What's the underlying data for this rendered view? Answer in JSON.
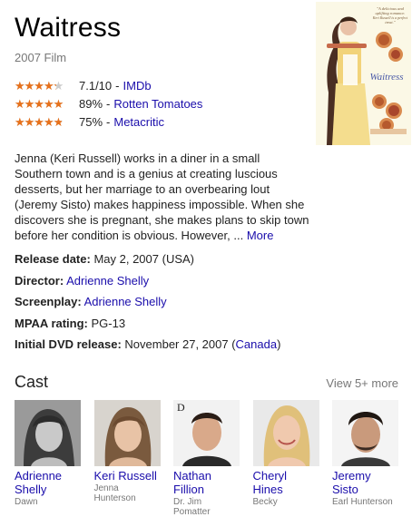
{
  "film": {
    "title": "Waitress",
    "subtitle": "2007 Film"
  },
  "poster": {
    "tagline_lines": [
      "\"A delicious and",
      "uplifting romance.",
      "Keri Russell is a perfect",
      "treat.\""
    ],
    "title": "Waitress"
  },
  "ratings": [
    {
      "stars": 3.5,
      "score": "7.1/10",
      "separator": "-",
      "source": "IMDb"
    },
    {
      "stars": 4.5,
      "score": "89%",
      "separator": "-",
      "source": "Rotten Tomatoes"
    },
    {
      "stars": 4.0,
      "score": "75%",
      "separator": "-",
      "source": "Metacritic"
    }
  ],
  "description": {
    "text": "Jenna (Keri Russell) works in a diner in a small Southern town and is a genius at creating luscious desserts, but her marriage to an overbearing lout (Jeremy Sisto) makes happiness impossible. When she discovers she is pregnant, she makes plans to skip town before her condition is obvious. However, ... ",
    "more": "More"
  },
  "facts": {
    "release": {
      "label": "Release date:",
      "value": "May 2, 2007 (USA)"
    },
    "director": {
      "label": "Director:",
      "link": "Adrienne Shelly"
    },
    "screenplay": {
      "label": "Screenplay:",
      "link": "Adrienne Shelly"
    },
    "mpaa": {
      "label": "MPAA rating:",
      "value": "PG-13"
    },
    "dvd": {
      "label": "Initial DVD release:",
      "value_before": "November 27, 2007 (",
      "link": "Canada",
      "value_after": ")"
    }
  },
  "cast": {
    "title": "Cast",
    "view_more": "View 5+ more",
    "members": [
      {
        "name_line1": "Adrienne",
        "name_line2": "Shelly",
        "role_line1": "Dawn",
        "role_line2": ""
      },
      {
        "name_line1": "Keri Russell",
        "name_line2": "",
        "role_line1": "Jenna",
        "role_line2": "Hunterson"
      },
      {
        "name_line1": "Nathan",
        "name_line2": "Fillion",
        "role_line1": "Dr. Jim",
        "role_line2": "Pomatter"
      },
      {
        "name_line1": "Cheryl",
        "name_line2": "Hines",
        "role_line1": "Becky",
        "role_line2": ""
      },
      {
        "name_line1": "Jeremy",
        "name_line2": "Sisto",
        "role_line1": "Earl Hunterson",
        "role_line2": ""
      }
    ]
  },
  "colors": {
    "link": "#1a0dab",
    "star": "#e7711b",
    "muted": "#777777"
  }
}
